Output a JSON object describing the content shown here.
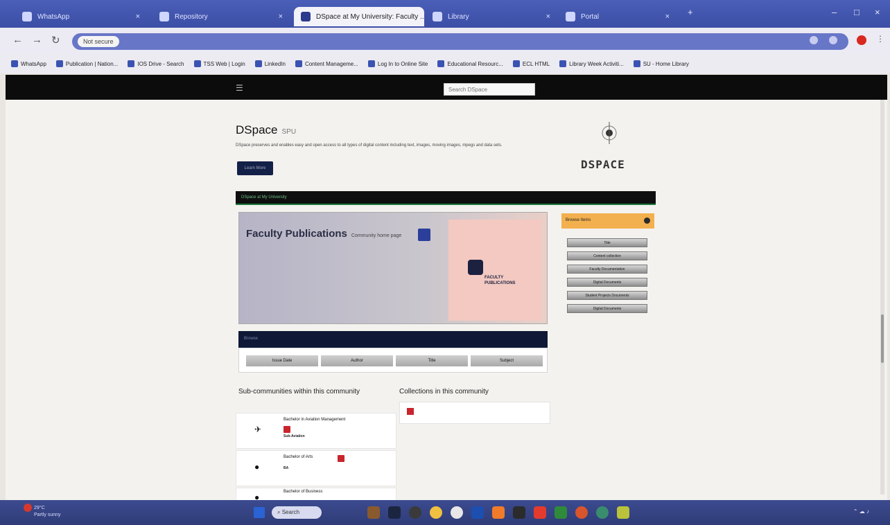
{
  "browser": {
    "tabs": [
      {
        "label": "WhatsApp",
        "active": false
      },
      {
        "label": "Repository",
        "active": false
      },
      {
        "label": "DSpace at My University: Faculty ...",
        "active": true
      },
      {
        "label": "Library",
        "active": false
      },
      {
        "label": "Portal",
        "active": false
      }
    ],
    "address": {
      "security_label": "Not secure",
      "url": ""
    },
    "bookmarks": [
      "WhatsApp",
      "Publication | Nation...",
      "IOS Drive - Search",
      "TSS Web | Login",
      "LinkedIn",
      "Content Manageme...",
      "Log In to Online Site",
      "Educational Resourc...",
      "ECL HTML",
      "Library Week Activiti...",
      "SU - Home Library"
    ]
  },
  "dspace": {
    "search_placeholder": "Search DSpace",
    "title": "DSpace",
    "subtitle": "SPU",
    "description": "DSpace preserves and enables easy and open access to all types of digital content including text, images, moving images, mpegs and data sets.",
    "more_button": "Learn More",
    "logo_text": "DSPACE",
    "breadcrumb": "DSpace at My University",
    "hero": {
      "title": "Faculty Publications",
      "subtitle": "Community home page",
      "logo_lines": [
        "FACULTY",
        "PUBLICATIONS"
      ]
    },
    "browse": {
      "heading": "Browse",
      "buttons": [
        "Issue Date",
        "Author",
        "Title",
        "Subject"
      ]
    },
    "sidebar": {
      "heading": "Browse Items",
      "buttons": [
        "Title",
        "Content collection",
        "Faculty Documentation",
        "Digital Documents",
        "Student Projects Documents",
        "Digital Documents"
      ]
    },
    "subcommunities": {
      "heading": "Sub-communities within this community",
      "items": [
        {
          "name": "Bachelor in Aviation Management",
          "sub": "Sub-Aviation"
        },
        {
          "name": "Bachelor of Arts",
          "sub": "BA"
        },
        {
          "name": "Bachelor of Business",
          "sub": ""
        }
      ]
    },
    "collections": {
      "heading": "Collections in this community"
    }
  },
  "taskbar": {
    "weather_line1": "29°C",
    "weather_line2": "Partly sunny",
    "search_label": "Search",
    "clock_time": "",
    "clock_date": ""
  },
  "colors": {
    "browser_accent": "#3c4ea6",
    "dspace_nav": "#0c0c0c",
    "breadcrumb_green": "#1e7a3e",
    "sidebar_orange": "#f2b04e",
    "rss_red": "#c9252c",
    "browse_head": "#0f1836"
  }
}
